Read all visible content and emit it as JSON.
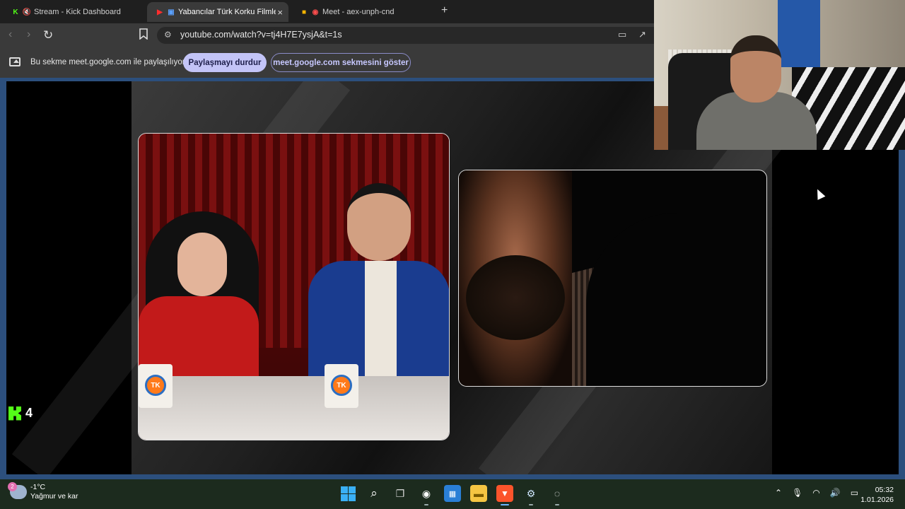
{
  "browser": {
    "tabs": [
      {
        "label": "Stream - Kick Dashboard",
        "active": false
      },
      {
        "label": "Yabancılar Türk Korku Filmleri",
        "active": true,
        "close": "×"
      },
      {
        "label": "Meet - aex-unph-cnd",
        "active": false
      }
    ],
    "new_tab": "+",
    "url": "youtube.com/watch?v=tj4H7E7ysjA&t=1s"
  },
  "share_bar": {
    "message": "Bu sekme meet.google.com ile paylaşılıyor",
    "stop_label": "Paylaşmayı durdur",
    "show_label": "meet.google.com sekmesini göster"
  },
  "video": {
    "mug_logo": "TK",
    "kick_viewers": "4"
  },
  "taskbar": {
    "weather_badge": "2",
    "temperature": "-1°C",
    "condition": "Yağmur ve kar",
    "time": "05:32",
    "date": "1.01.2026"
  },
  "colors": {
    "accent": "#c3c4f7",
    "kick_green": "#53fc18",
    "viewport_border": "#2c4f7d",
    "taskbar": "#1c2b1e"
  },
  "icons": [
    "kick-icon",
    "mute-icon",
    "youtube-icon",
    "meet-icon",
    "record-icon",
    "back-icon",
    "forward-icon",
    "reload-icon",
    "bookmark-icon",
    "site-info-icon",
    "cast-icon",
    "share-icon",
    "screen-share-icon",
    "windows-start-icon",
    "search-icon",
    "task-view-icon",
    "widgets-icon",
    "store-icon",
    "file-explorer-icon",
    "brave-icon",
    "steam-icon",
    "app-icon",
    "chevron-up-icon",
    "microphone-icon",
    "wifi-icon",
    "volume-icon",
    "battery-icon"
  ]
}
